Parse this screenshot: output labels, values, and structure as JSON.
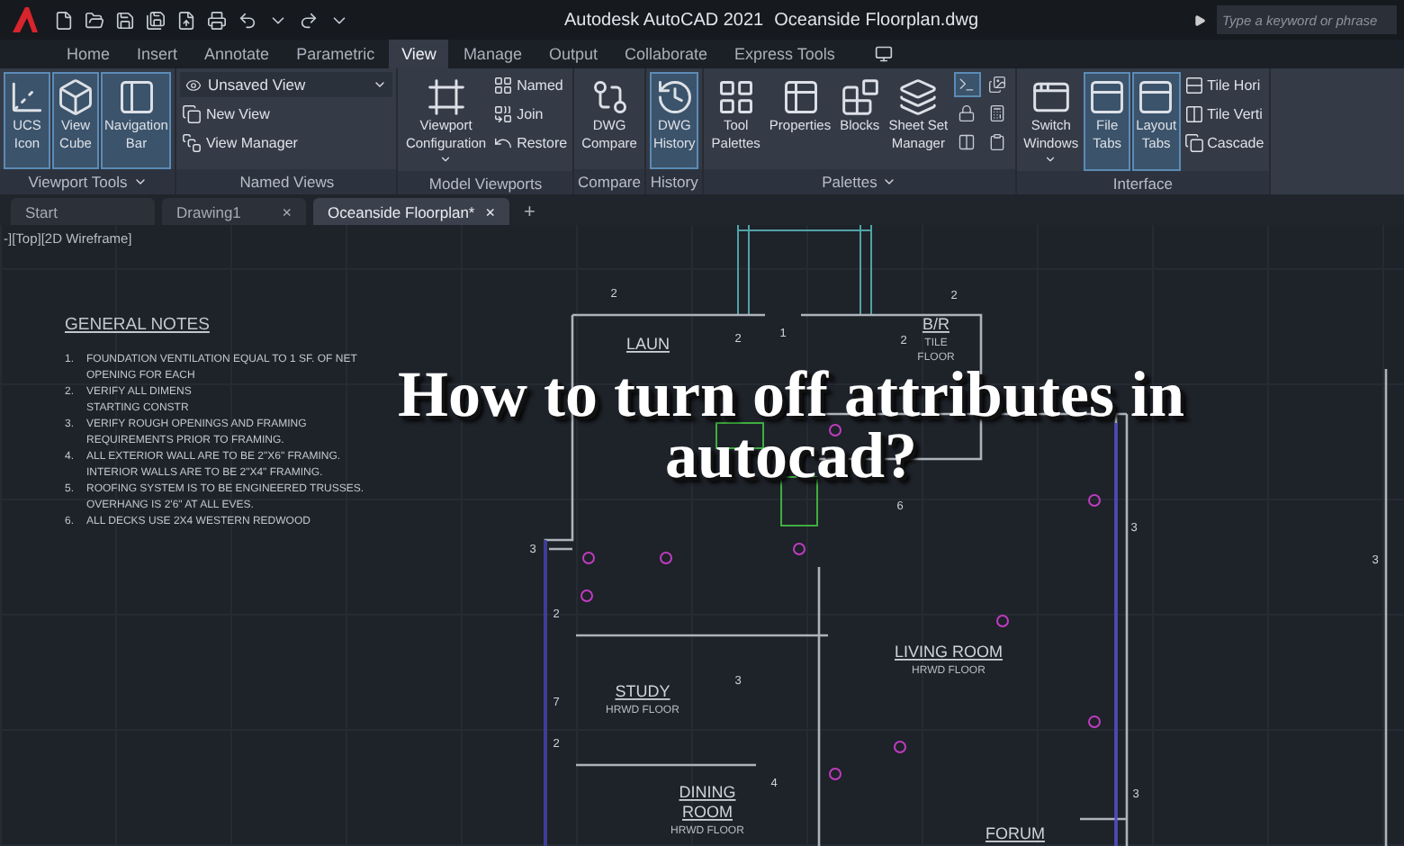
{
  "title_bar": {
    "app_title": "Autodesk AutoCAD 2021",
    "file_name": "Oceanside Floorplan.dwg",
    "search": {
      "placeholder": "Type a keyword or phrase"
    }
  },
  "ribbon_tabs": [
    {
      "label": "Home",
      "selected": false
    },
    {
      "label": "Insert",
      "selected": false
    },
    {
      "label": "Annotate",
      "selected": false
    },
    {
      "label": "Parametric",
      "selected": false
    },
    {
      "label": "View",
      "selected": true
    },
    {
      "label": "Manage",
      "selected": false
    },
    {
      "label": "Output",
      "selected": false
    },
    {
      "label": "Collaborate",
      "selected": false
    },
    {
      "label": "Express Tools",
      "selected": false
    }
  ],
  "ribbon_panels": [
    {
      "title": "Viewport Tools",
      "menu": true,
      "items": [
        {
          "kind": "large",
          "lines": [
            "UCS",
            "Icon"
          ],
          "on": true,
          "menu": false
        },
        {
          "kind": "large",
          "lines": [
            "View",
            "Cube"
          ],
          "on": true,
          "menu": false
        },
        {
          "kind": "large",
          "lines": [
            "Navigation",
            "Bar"
          ],
          "on": true,
          "menu": false
        }
      ]
    },
    {
      "title": "Named Views",
      "menu": false,
      "items": [
        {
          "kind": "stack",
          "items": [
            {
              "kind": "dropdown",
              "label": "Unsaved View"
            },
            {
              "kind": "small",
              "label": "New View"
            },
            {
              "kind": "small",
              "label": "View Manager"
            }
          ]
        }
      ]
    },
    {
      "title": "Model Viewports",
      "menu": false,
      "items": [
        {
          "kind": "large",
          "lines": [
            "Viewport",
            "Configuration"
          ],
          "on": false,
          "menu": true
        },
        {
          "kind": "stack",
          "items": [
            {
              "kind": "small",
              "label": "Named"
            },
            {
              "kind": "small",
              "label": "Join"
            },
            {
              "kind": "small",
              "label": "Restore"
            }
          ]
        }
      ]
    },
    {
      "title": "Compare",
      "menu": false,
      "items": [
        {
          "kind": "large",
          "lines": [
            "DWG",
            "Compare"
          ],
          "on": false,
          "menu": false
        }
      ]
    },
    {
      "title": "History",
      "menu": false,
      "items": [
        {
          "kind": "large",
          "lines": [
            "DWG",
            "History"
          ],
          "on": true,
          "menu": false
        }
      ]
    },
    {
      "title": "Palettes",
      "menu": true,
      "items": [
        {
          "kind": "large",
          "lines": [
            "Tool",
            "Palettes"
          ],
          "on": false,
          "menu": false
        },
        {
          "kind": "large",
          "lines": [
            "Properties"
          ],
          "on": false,
          "menu": false
        },
        {
          "kind": "large",
          "lines": [
            "Blocks"
          ],
          "on": false,
          "menu": false
        },
        {
          "kind": "large",
          "lines": [
            "Sheet Set",
            "Manager"
          ],
          "on": false,
          "menu": false
        },
        {
          "kind": "grid",
          "items": [
            {
              "on": true
            },
            {
              "on": false
            },
            {
              "on": false
            },
            {
              "on": false
            },
            {
              "on": false
            },
            {
              "on": false
            }
          ]
        }
      ]
    },
    {
      "title": "Interface",
      "menu": false,
      "items": [
        {
          "kind": "large",
          "lines": [
            "Switch",
            "Windows"
          ],
          "on": false,
          "menu": true
        },
        {
          "kind": "large",
          "lines": [
            "File",
            "Tabs"
          ],
          "on": true,
          "menu": false
        },
        {
          "kind": "large",
          "lines": [
            "Layout",
            "Tabs"
          ],
          "on": true,
          "menu": false
        },
        {
          "kind": "stack",
          "items": [
            {
              "kind": "small",
              "label": "Tile Hori"
            },
            {
              "kind": "small",
              "label": "Tile Verti"
            },
            {
              "kind": "small",
              "label": "Cascade"
            }
          ]
        }
      ]
    }
  ],
  "document_tabs": [
    {
      "label": "Start",
      "selected": false
    },
    {
      "label": "Drawing1",
      "selected": false,
      "close": "×"
    },
    {
      "label": "Oceanside Floorplan*",
      "selected": true,
      "close": "×"
    }
  ],
  "new_tab": "+",
  "canvas": {
    "viewport_label": "-][Top][2D Wireframe]",
    "notes_title": "GENERAL NOTES",
    "notes": [
      {
        "number": "1.",
        "lines": [
          "FOUNDATION VENTILATION EQUAL TO 1 SF. OF NET",
          "OPENING FOR EACH"
        ]
      },
      {
        "number": "2.",
        "lines": [
          "VERIFY ALL DIMENS",
          "STARTING CONSTR"
        ]
      },
      {
        "number": "3.",
        "lines": [
          "VERIFY ROUGH OPENINGS AND FRAMING",
          "REQUIREMENTS PRIOR TO FRAMING."
        ]
      },
      {
        "number": "4.",
        "lines": [
          "ALL EXTERIOR WALL ARE TO BE 2\"X6\" FRAMING.",
          "INTERIOR WALLS ARE TO BE 2\"X4\" FRAMING."
        ]
      },
      {
        "number": "5.",
        "lines": [
          "ROOFING SYSTEM IS TO BE ENGINEERED TRUSSES.",
          "OVERHANG IS 2'6\" AT ALL EVES."
        ]
      },
      {
        "number": "6.",
        "lines": [
          "ALL DECKS USE 2X4 WESTERN REDWOOD"
        ]
      }
    ],
    "rooms": [
      {
        "name_lines": [
          "LAUN"
        ]
      },
      {
        "name_lines": [
          "B/R"
        ],
        "floor_lines": [
          "TILE",
          "FLOOR"
        ]
      },
      {
        "name_lines": [
          "STUDY"
        ],
        "floor_lines": [
          "HRWD FLOOR"
        ]
      },
      {
        "name_lines": [
          "DINING",
          "ROOM"
        ],
        "floor_lines": [
          "HRWD FLOOR"
        ]
      },
      {
        "name_lines": [
          "LIVING ROOM"
        ],
        "floor_lines": [
          "HRWD FLOOR"
        ]
      },
      {
        "name_lines": [
          "FORUM"
        ]
      }
    ],
    "dimension_marks": [
      "2",
      "2",
      "1",
      "2",
      "2",
      "3",
      "2",
      "7",
      "2",
      "3",
      "4",
      "3",
      "3",
      "6",
      "3"
    ]
  },
  "overlay_title": "How to turn off attributes in autocad?"
}
